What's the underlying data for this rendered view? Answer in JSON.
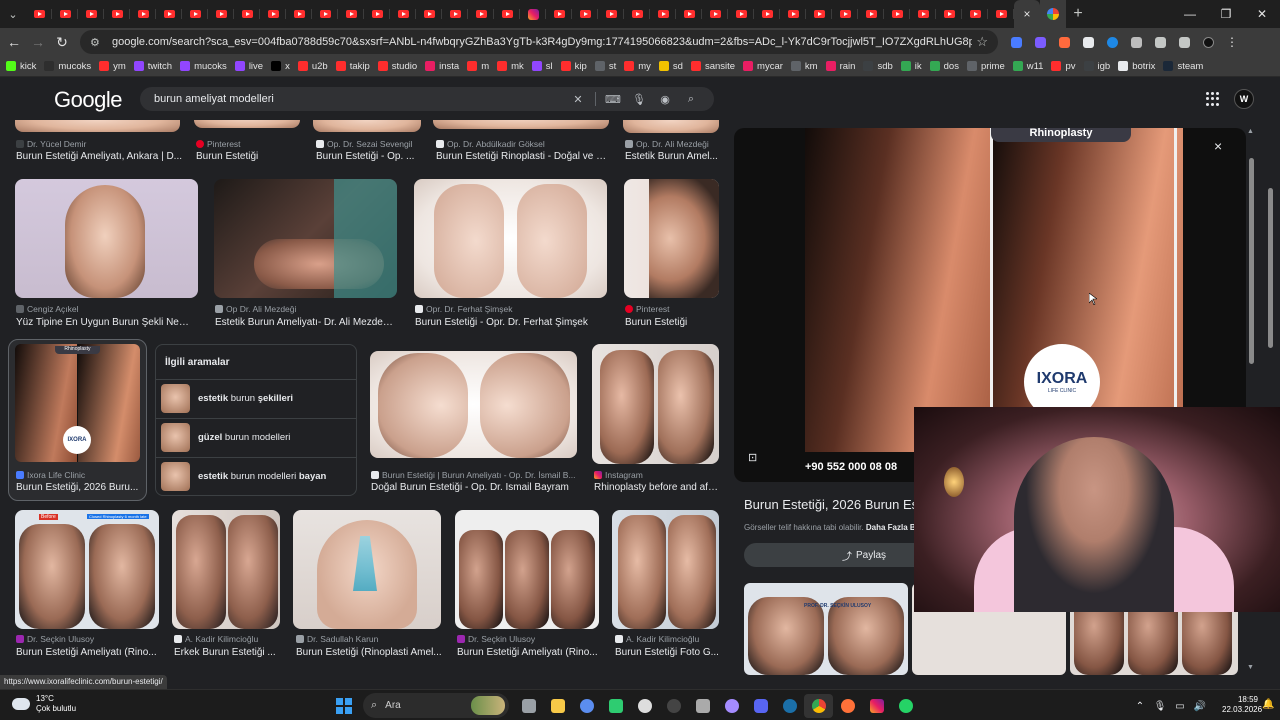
{
  "browser": {
    "url": "google.com/search?sca_esv=004fba0788d59c70&sxsrf=ANbL-n4fwbqryGZhBa3YgTb-k3R4gDy9mg:1774195066823&udm=2&fbs=ADc_l-Yk7dC9rTocjjwl5T_IO7ZXgdRLhUG8pk-pM063RkPILfDIfEXPwaXG5eHv...",
    "tab_count_icons": "youtube, instagram",
    "new_tab": "+",
    "tab_close": "×"
  },
  "bookmarks": [
    {
      "label": "kick",
      "color": "#53fc18"
    },
    {
      "label": "mucoks",
      "color": "#2e2e2e"
    },
    {
      "label": "ym",
      "color": "#ff2d2d"
    },
    {
      "label": "twitch",
      "color": "#9146ff"
    },
    {
      "label": "mucoks",
      "color": "#9146ff"
    },
    {
      "label": "live",
      "color": "#9146ff"
    },
    {
      "label": "x",
      "color": "#000000"
    },
    {
      "label": "u2b",
      "color": "#ff2d2d"
    },
    {
      "label": "takip",
      "color": "#ff2d2d"
    },
    {
      "label": "studio",
      "color": "#ff2d2d"
    },
    {
      "label": "insta",
      "color": "#e91e63"
    },
    {
      "label": "m",
      "color": "#ff2d2d"
    },
    {
      "label": "mk",
      "color": "#ff2d2d"
    },
    {
      "label": "sl",
      "color": "#9146ff"
    },
    {
      "label": "kip",
      "color": "#ff2d2d"
    },
    {
      "label": "st",
      "color": "#5f6368"
    },
    {
      "label": "my",
      "color": "#ff2d2d"
    },
    {
      "label": "sd",
      "color": "#f2c200"
    },
    {
      "label": "sansite",
      "color": "#ff2d2d"
    },
    {
      "label": "mycar",
      "color": "#e91e63"
    },
    {
      "label": "km",
      "color": "#5f6368"
    },
    {
      "label": "rain",
      "color": "#e91e63"
    },
    {
      "label": "sdb",
      "color": "#3c4043"
    },
    {
      "label": "ik",
      "color": "#34a853"
    },
    {
      "label": "dos",
      "color": "#34a853"
    },
    {
      "label": "prime",
      "color": "#5f6368"
    },
    {
      "label": "w11",
      "color": "#34a853"
    },
    {
      "label": "pv",
      "color": "#ff2d2d"
    },
    {
      "label": "igb",
      "color": "#3c4043"
    },
    {
      "label": "botrix",
      "color": "#e8eaed"
    },
    {
      "label": "steam",
      "color": "#1b2838"
    }
  ],
  "google": {
    "logo": "Google",
    "query": "burun ameliyat modelleri"
  },
  "results": {
    "row0": [
      {
        "source": "Dr. Yücel Demir",
        "title": "Burun Estetiği Ameliyatı, Ankara | D..."
      },
      {
        "source": "Pinterest",
        "title": "Burun Estetiği"
      },
      {
        "source": "Op. Dr. Sezai Sevengil",
        "title": "Burun Estetiği - Op. ..."
      },
      {
        "source": "Op. Dr. Abdülkadir Göksel",
        "title": "Burun Estetiği Rinoplasti - Doğal ve F..."
      },
      {
        "source": "Op. Dr. Ali Mezdeği",
        "title": "Estetik Burun Amel..."
      }
    ],
    "row1": [
      {
        "source": "Cengiz Açıkel",
        "title": "Yüz Tipine En Uygun Burun Şekli Nedir..."
      },
      {
        "source": "Op Dr. Ali Mezdeği",
        "title": "Estetik Burun Ameliyatı- Dr. Ali Mezdeği..."
      },
      {
        "source": "Opr. Dr. Ferhat Şimşek",
        "title": "Burun Estetiği - Opr. Dr. Ferhat Şimşek"
      },
      {
        "source": "Pinterest",
        "title": "Burun Estetiği"
      }
    ],
    "row2": [
      {
        "source": "Ixora Life Clinic",
        "title": "Burun Estetiği, 2026 Buru..."
      },
      {
        "source": "Burun Estetiği | Burun Ameliyatı - Op. Dr. İsmail B...",
        "title": "Doğal Burun Estetiği - Op. Dr. İsmail Bayram"
      },
      {
        "source": "Instagram",
        "title": "Rhinoplasty before and aft..."
      }
    ],
    "row3": [
      {
        "source": "Dr. Seçkin Ulusoy",
        "title": "Burun Estetiği Ameliyatı (Rino..."
      },
      {
        "source": "A. Kadir Kilimcioğlu",
        "title": "Erkek Burun Estetiği ..."
      },
      {
        "source": "Dr. Sadullah Karun",
        "title": "Burun Estetiği (Rinoplasti Amel..."
      },
      {
        "source": "Dr. Seçkin Ulusoy",
        "title": "Burun Estetiği Ameliyatı (Rino..."
      },
      {
        "source": "A. Kadir Kilimcioğlu",
        "title": "Burun Estetiği Foto G..."
      }
    ],
    "thumb_labels": {
      "rhinoplasty": "Rhinoplasty",
      "ixora": "IXORA",
      "before": "Before",
      "closed": "Closed Rhinoplasty 6 month late",
      "doctor": "PROF. DR. SEÇKİN ULUSOY"
    }
  },
  "related": {
    "heading": "İlgili aramalar",
    "items": [
      {
        "bold": "estetik",
        "rest": " burun ",
        "bold2": "şekilleri"
      },
      {
        "bold": "güzel",
        "rest": " burun modelleri",
        "bold2": ""
      },
      {
        "bold": "estetik",
        "rest": " burun modelleri ",
        "bold2": "bayan"
      }
    ]
  },
  "panel": {
    "image_tag": "Rhinoplasty",
    "logo_text": "IXORA",
    "logo_sub": "LIFE CLINIC",
    "phone": "+90 552 000 08 08",
    "title": "Burun Estetiği, 2026 Burun Estet",
    "note": "Görseller telif hakkına tabi olabilir.",
    "note_link": "Daha Fazla B",
    "share": "Paylaş",
    "close": "×"
  },
  "status_url": "https://www.ixoralifeclinic.com/burun-estetigi/",
  "taskbar": {
    "temp": "13°C",
    "weather": "Çok bulutlu",
    "search": "Ara",
    "time": "18:59",
    "date": "22.03.2026"
  }
}
